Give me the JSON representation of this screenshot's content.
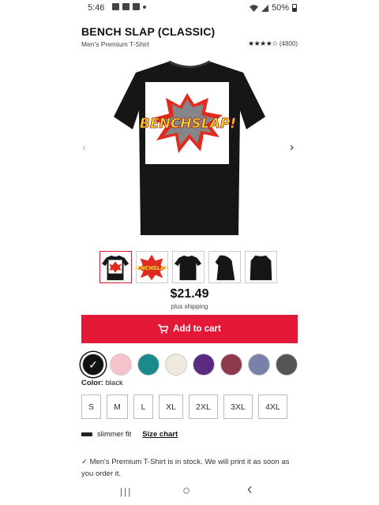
{
  "status": {
    "time": "5:46",
    "battery": "50%"
  },
  "product": {
    "title": "BENCH SLAP (CLASSIC)",
    "subtitle": "Men's Premium T-Shirt",
    "rating_count": "(4800)",
    "stars": "★★★★☆",
    "design_text": "BENCHSLAP!",
    "price": "$21.49",
    "shipping": "plus shipping"
  },
  "cart": {
    "label": "Add to cart"
  },
  "colors": {
    "label": "Color:",
    "selected": "black",
    "swatches": [
      "#111111",
      "#f6c3cc",
      "#1a8a8c",
      "#efe9de",
      "#5b2a82",
      "#8e3a4c",
      "#7981a8",
      "#555555"
    ]
  },
  "sizes": [
    "S",
    "M",
    "L",
    "XL",
    "2XL",
    "3XL",
    "4XL"
  ],
  "fit": {
    "label": "slimmer fit",
    "chart_link": "Size chart"
  },
  "stock": {
    "text": "✓ Men's Premium T-Shirt is in stock. We will print it as soon as you order it."
  },
  "icons": {
    "arrow_left": "‹",
    "arrow_right": "›",
    "nav_recent": "|||",
    "nav_home": "○",
    "nav_back": "‹"
  }
}
